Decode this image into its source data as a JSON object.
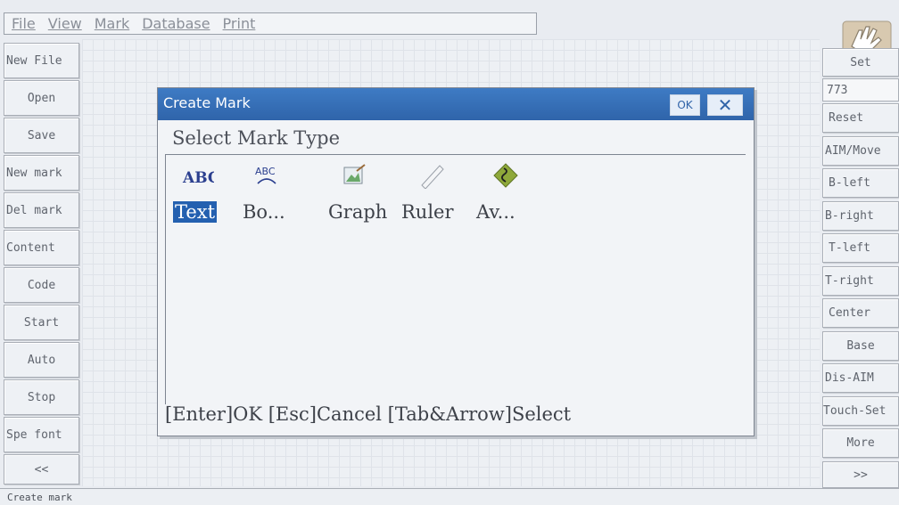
{
  "menubar": {
    "items": [
      "File",
      "View",
      "Mark",
      "Database",
      "Print"
    ]
  },
  "left_buttons": [
    "New File",
    "Open",
    "Save",
    "New mark",
    "Del mark",
    "Content",
    "Code",
    "Start",
    "Auto",
    "Stop",
    "Spe font",
    "<<"
  ],
  "right_panel": {
    "set_label": "Set",
    "field_value": "773",
    "buttons": [
      "Reset",
      "AIM/Move",
      "B-left",
      "B-right",
      "T-left",
      "T-right",
      "Center",
      "Base",
      "Dis-AIM",
      "Touch-Set",
      "More",
      ">>"
    ]
  },
  "status": {
    "text": "Create mark"
  },
  "dialog": {
    "title": "Create Mark",
    "ok_label": "OK",
    "close_label": "✕",
    "heading": "Select Mark Type",
    "types": [
      {
        "label": "Text",
        "icon": "abc-text-icon",
        "selected": true
      },
      {
        "label": "Bo...",
        "icon": "arc-text-icon",
        "selected": false
      },
      {
        "label": "Graph",
        "icon": "image-icon",
        "selected": false
      },
      {
        "label": "Ruler",
        "icon": "ruler-icon",
        "selected": false
      },
      {
        "label": "Av...",
        "icon": "diamond-curve-icon",
        "selected": false
      }
    ],
    "footer": "[Enter]OK [Esc]Cancel [Tab&Arrow]Select"
  },
  "colors": {
    "title_bar": "#3e7bc4",
    "selection": "#2460b0",
    "background": "#e9ecf1"
  }
}
